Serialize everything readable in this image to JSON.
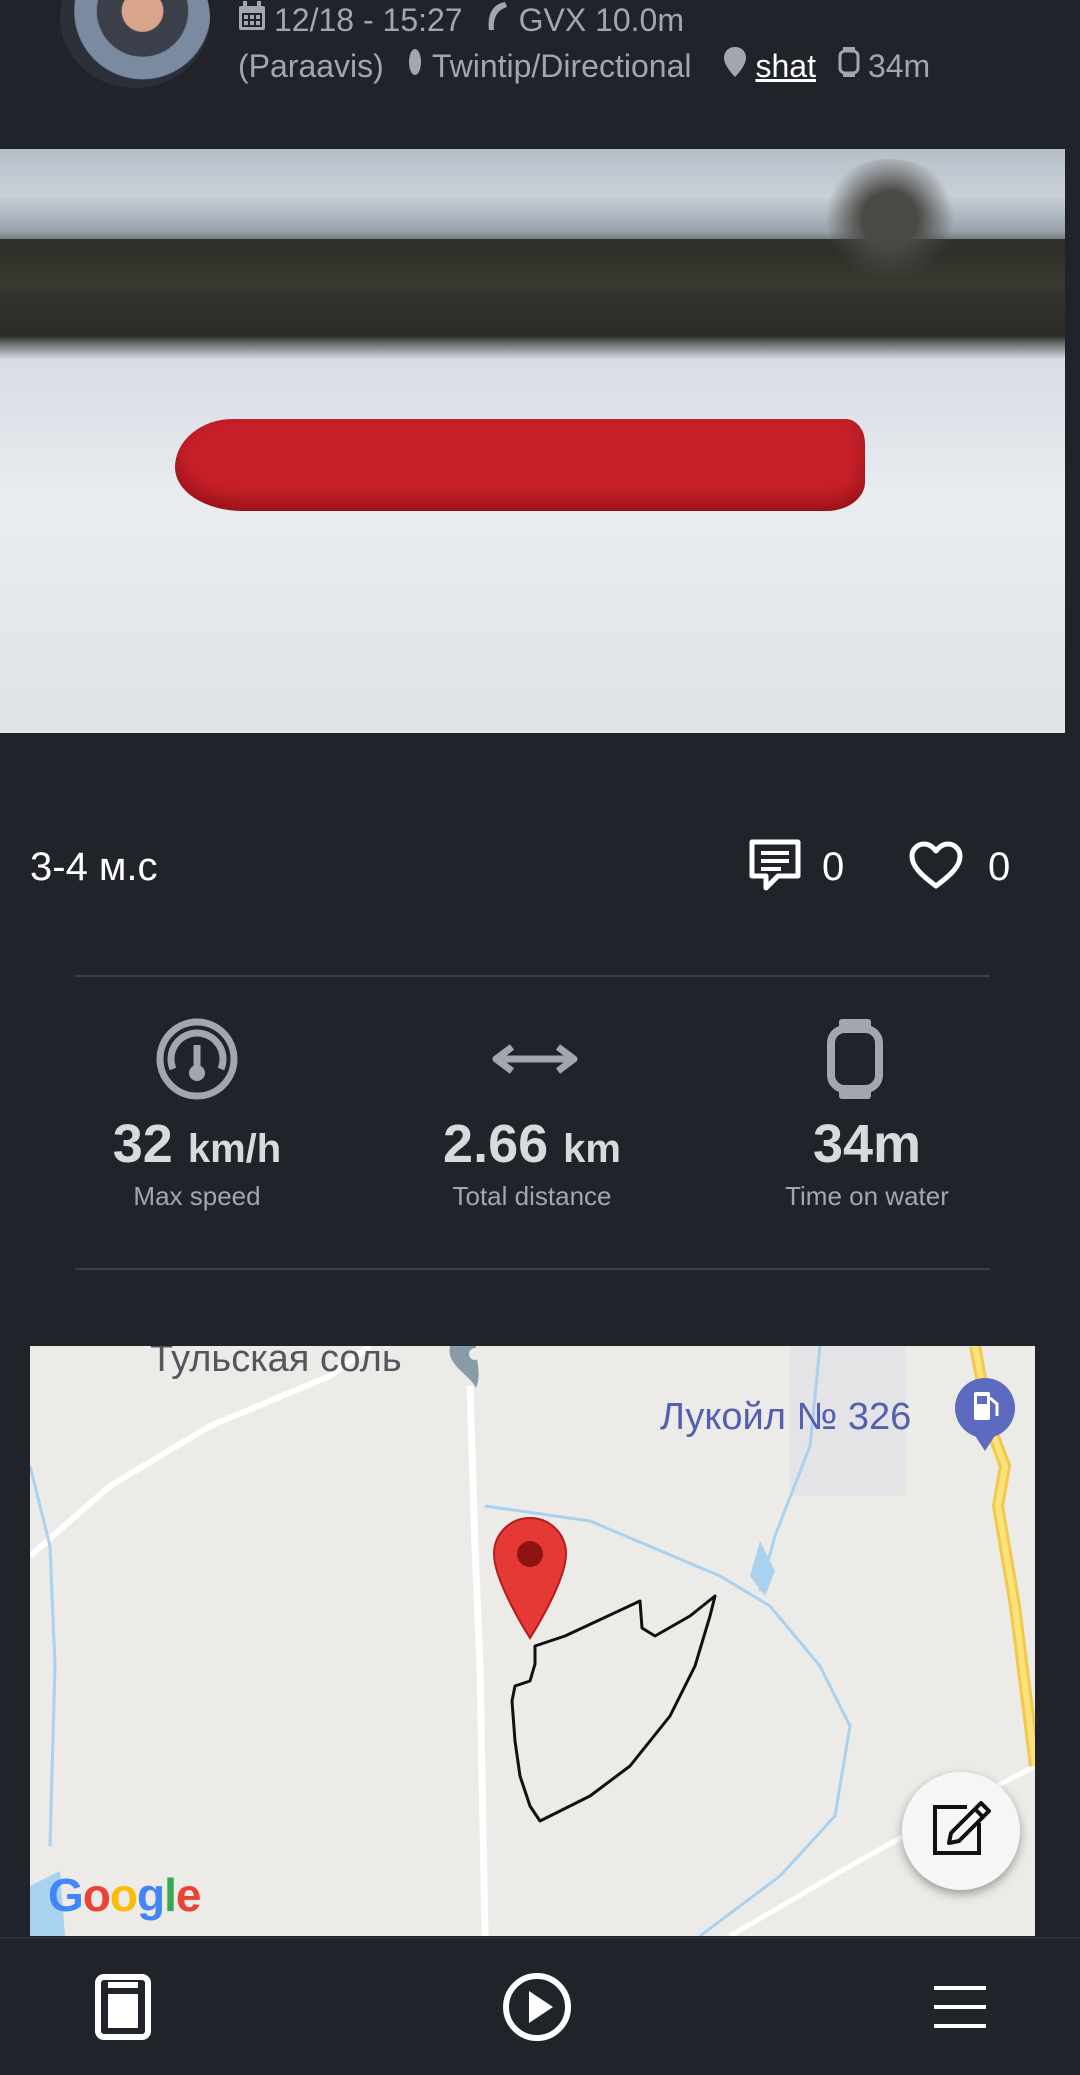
{
  "post": {
    "date": "12/18 - 15:27",
    "kite": "GVX 10.0m",
    "brand": "(Paraavis)",
    "board": "Twintip/Directional",
    "user": "shat",
    "duration": "34m",
    "caption": "3-4 м.с",
    "comments_count": "0",
    "likes_count": "0"
  },
  "stats": [
    {
      "icon": "speedometer-icon",
      "value": "32",
      "unit": "km/h",
      "label": "Max speed"
    },
    {
      "icon": "distance-arrows-icon",
      "value": "2.66",
      "unit": "km",
      "label": "Total distance"
    },
    {
      "icon": "watch-icon",
      "value": "34m",
      "unit": "",
      "label": "Time on water"
    }
  ],
  "map": {
    "place_1": "Тульская соль",
    "place_2": "Лукойл № 326",
    "provider": "Google"
  },
  "colors": {
    "background": "#21232a",
    "muted_text": "#a3a6ad",
    "map_marker": "#e53935"
  }
}
